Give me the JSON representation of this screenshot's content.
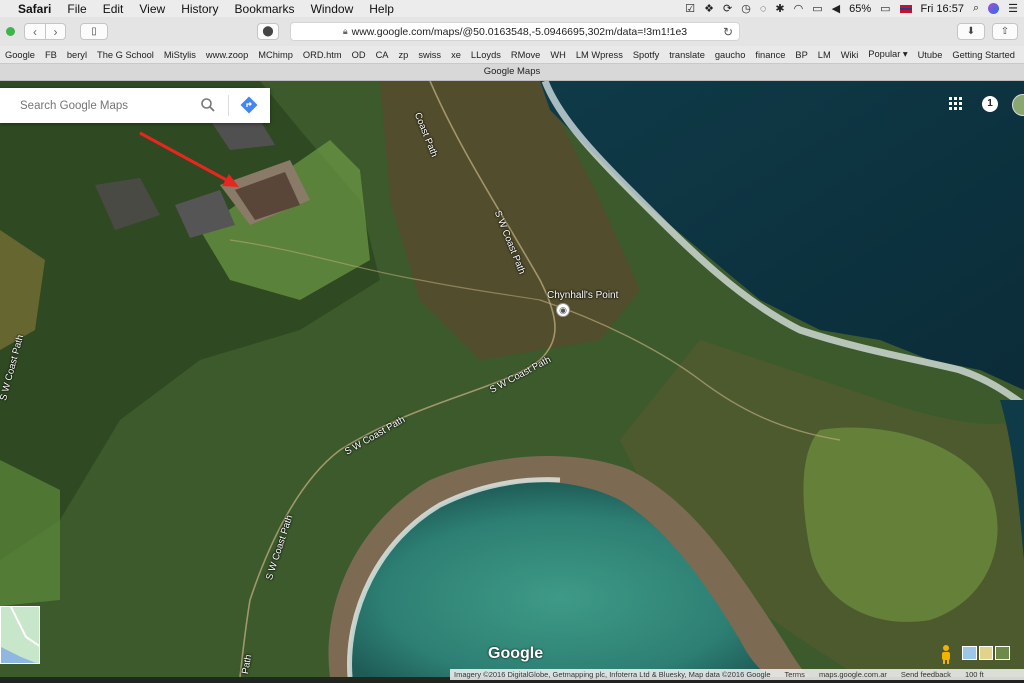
{
  "menubar": {
    "app": "Safari",
    "items": [
      "File",
      "Edit",
      "View",
      "History",
      "Bookmarks",
      "Window",
      "Help"
    ],
    "battery": "65%",
    "clock": "Fri 16:57"
  },
  "toolbar": {
    "url": "www.google.com/maps/@50.0163548,-5.0946695,302m/data=!3m1!1e3"
  },
  "bookmarks": [
    "Google",
    "FB",
    "beryl",
    "The G School",
    "MiStylis",
    "www.zoop",
    "MChimp",
    "ORD.htm",
    "OD",
    "CA",
    "zp",
    "swiss",
    "xe",
    "LLoyds",
    "RMove",
    "WH",
    "LM Wpress",
    "Spotfy",
    "translate",
    "gaucho",
    "finance",
    "BP",
    "LM",
    "Wiki",
    "Popular ▾",
    "Utube",
    "Getting Started"
  ],
  "tab": {
    "title": "Google Maps"
  },
  "search": {
    "placeholder": "Search Google Maps"
  },
  "map": {
    "poi": "Chynhall's Point",
    "paths": [
      "Coast Path",
      "S W Coast Path",
      "S W Coast Path",
      "S W Coast Path",
      "S W Coast Path",
      "S W Coast Path",
      "Path"
    ],
    "notification_count": "1",
    "logo": "Google",
    "attribution": {
      "imagery": "Imagery ©2016 DigitalGlobe, Getmapping plc, Infoterra Ltd & Bluesky, Map data ©2016 Google",
      "terms": "Terms",
      "site": "maps.google.com.ar",
      "feedback": "Send feedback",
      "scale": "100 ft"
    }
  },
  "colors": {
    "accent": "#4285f4",
    "arrow": "#e8261f"
  }
}
